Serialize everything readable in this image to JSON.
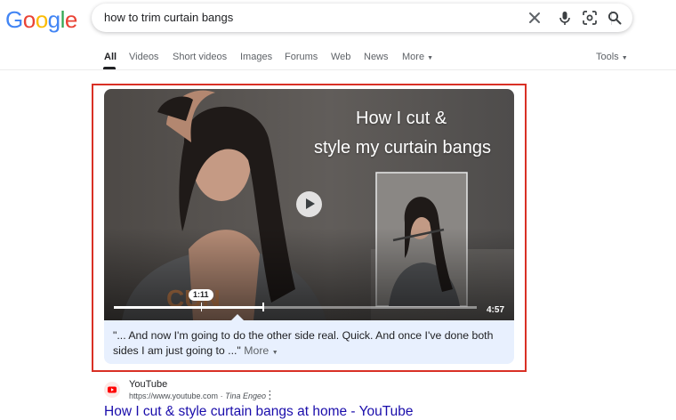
{
  "logo": {
    "letters": [
      "G",
      "o",
      "o",
      "g",
      "l",
      "e"
    ],
    "colors": [
      "#4285F4",
      "#EA4335",
      "#FBBC05",
      "#4285F4",
      "#34A853",
      "#EA4335"
    ]
  },
  "search": {
    "query": "how to trim curtain bangs"
  },
  "icons": {
    "clear": "close-icon",
    "voice": "microphone-icon",
    "lens": "camera-lens-icon",
    "search": "search-icon"
  },
  "tabs": [
    {
      "label": "All",
      "active": true
    },
    {
      "label": "Videos"
    },
    {
      "label": "Short videos"
    },
    {
      "label": "Images"
    },
    {
      "label": "Forums"
    },
    {
      "label": "Web"
    },
    {
      "label": "News"
    },
    {
      "label": "More"
    }
  ],
  "tools_label": "Tools",
  "video": {
    "overlay_title_line1": "How I cut &",
    "overlay_title_line2": "style my curtain bangs",
    "timestamp_chip": "1:11",
    "duration": "4:57",
    "progress_fraction": 0.41,
    "key_moment_fraction": 0.24,
    "quote": "\"... And now I'm going to do the other side real. Quick. And once I've done both sides I am just going to ...\"",
    "more_label": "More"
  },
  "result": {
    "site_name": "YouTube",
    "url": "https://www.youtube.com",
    "author": "Tina Engeo",
    "title": "How I cut & style curtain bangs at home - YouTube"
  },
  "colors": {
    "highlight_border": "#d93025",
    "link": "#1a0dab",
    "snippet_background": "#e8f0fe",
    "youtube_red": "#ff0000"
  }
}
